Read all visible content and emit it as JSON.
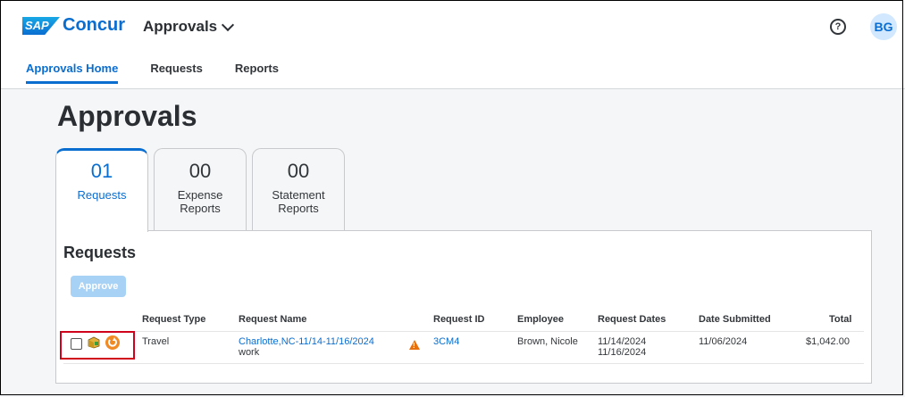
{
  "app": {
    "logo_sap": "SAP",
    "logo_name": "Concur",
    "switcher_label": "Approvals",
    "avatar_initials": "BG",
    "help_glyph": "?"
  },
  "nav": {
    "items": [
      "Approvals Home",
      "Requests",
      "Reports"
    ],
    "active": "Approvals Home"
  },
  "page": {
    "title": "Approvals"
  },
  "tabs": [
    {
      "count": "01",
      "label": "Requests"
    },
    {
      "count": "00",
      "label": "Expense Reports"
    },
    {
      "count": "00",
      "label": "Statement Reports"
    }
  ],
  "requests": {
    "title": "Requests",
    "approve_label": "Approve",
    "columns": [
      "Request Type",
      "Request Name",
      "Request ID",
      "Employee",
      "Request Dates",
      "Date Submitted",
      "Total"
    ],
    "rows": [
      {
        "type": "Travel",
        "name_link": "Charlotte,NC-11/14-11/16/2024",
        "name_sub": "work",
        "warning": "!",
        "id": "3CM4",
        "employee": "Brown, Nicole",
        "date_start": "11/14/2024",
        "date_end": "11/16/2024",
        "submitted": "11/06/2024",
        "total": "$1,042.00"
      }
    ]
  },
  "colors": {
    "accent": "#0a6ed1",
    "warning": "#e8700b",
    "highlight": "#d0021b",
    "approve_disabled": "#a8d2f5"
  },
  "icons": [
    "help-icon",
    "chevron-down-icon",
    "request-package-icon",
    "recall-cycle-icon",
    "warning-icon"
  ]
}
